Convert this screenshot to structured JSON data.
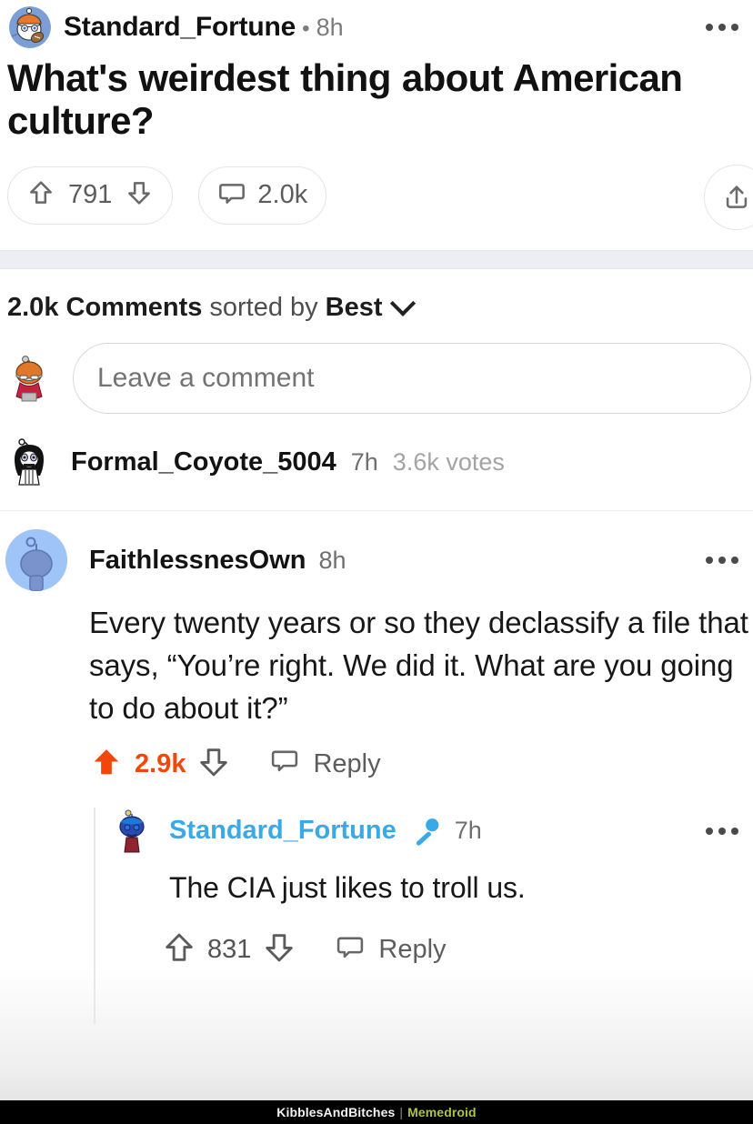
{
  "post": {
    "author": "Standard_Fortune",
    "separator": "•",
    "timestamp": "8h",
    "title": "What's weirdest thing about American culture?",
    "avatar_icon": "snoo-football-helmet-avatar",
    "overflow_icon": "more-options-icon",
    "actions": {
      "upvote_icon": "upvote-arrow-icon",
      "score": "791",
      "downvote_icon": "downvote-arrow-icon",
      "comment_icon": "comment-bubble-icon",
      "comment_count": "2.0k",
      "share_icon": "share-icon"
    }
  },
  "comments_header": {
    "count_label": "2.0k Comments",
    "sorted_by_label": "sorted by",
    "sort_value": "Best",
    "chevron_icon": "chevron-down-icon"
  },
  "composer": {
    "avatar_icon": "snoo-orange-hair-avatar",
    "placeholder": "Leave a comment"
  },
  "collapsed_comment": {
    "avatar_icon": "snoo-dark-hair-avatar",
    "author": "Formal_Coyote_5004",
    "timestamp": "7h",
    "votes": "3.6k votes"
  },
  "comment": {
    "avatar_icon": "snoo-default-blue-avatar",
    "author": "FaithlessnesOwn",
    "timestamp": "8h",
    "overflow_icon": "more-options-icon",
    "body": "Every twenty years or so they declassify a file that says, “You’re right. We did it. What are you going to do about it?”",
    "actions": {
      "upvote_icon": "upvote-arrow-filled-icon",
      "score": "2.9k",
      "downvote_icon": "downvote-arrow-icon",
      "reply_icon": "reply-bubble-icon",
      "reply_label": "Reply"
    }
  },
  "reply": {
    "avatar_icon": "snoo-blue-hat-avatar",
    "author": "Standard_Fortune",
    "op_badge_icon": "microphone-op-icon",
    "timestamp": "7h",
    "overflow_icon": "more-options-icon",
    "body": "The CIA just likes to troll us.",
    "actions": {
      "upvote_icon": "upvote-arrow-icon",
      "score": "831",
      "downvote_icon": "downvote-arrow-icon",
      "reply_icon": "reply-bubble-icon",
      "reply_label": "Reply"
    }
  },
  "watermark": {
    "left": "KibblesAndBitches",
    "separator": "|",
    "right": "Memedroid"
  },
  "colors": {
    "upvote_orange": "#f4460a",
    "op_blue": "#3aa9e8",
    "band_gray": "#edeef4",
    "memedroid_green": "#aec43c"
  }
}
